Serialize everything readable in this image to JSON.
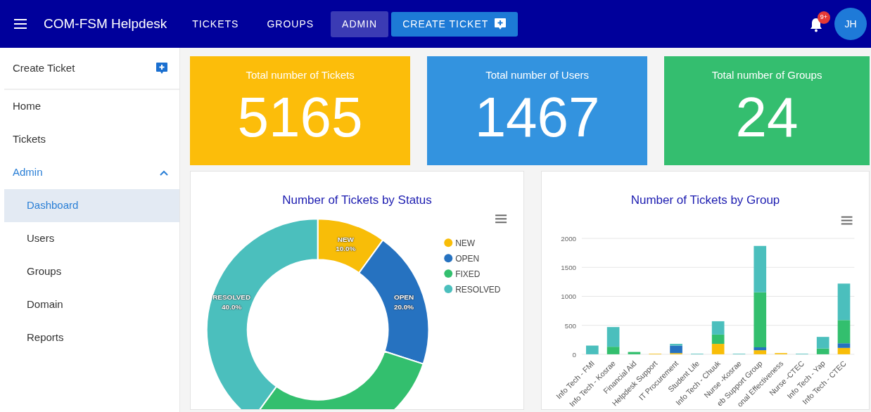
{
  "navbar": {
    "brand": "COM-FSM Helpdesk",
    "tabs": [
      {
        "label": "TICKETS",
        "selected": false
      },
      {
        "label": "GROUPS",
        "selected": false
      },
      {
        "label": "ADMIN",
        "selected": true
      }
    ],
    "create_button": "CREATE TICKET",
    "notification_badge": "9+",
    "avatar": "JH"
  },
  "sidebar": {
    "create_item": "Create Ticket",
    "items": [
      {
        "label": "Home",
        "selected": false
      },
      {
        "label": "Tickets",
        "selected": false
      },
      {
        "label": "Admin",
        "selected": false,
        "expanded": true,
        "children": [
          {
            "label": "Dashboard",
            "selected": true
          },
          {
            "label": "Users",
            "selected": false
          },
          {
            "label": "Groups",
            "selected": false
          },
          {
            "label": "Domain",
            "selected": false
          },
          {
            "label": "Reports",
            "selected": false
          }
        ]
      }
    ]
  },
  "stats": [
    {
      "label": "Total number of Tickets",
      "value": "5165",
      "color": "#fcbd0a"
    },
    {
      "label": "Total number of Users",
      "value": "1467",
      "color": "#3393df"
    },
    {
      "label": "Total number of Groups",
      "value": "24",
      "color": "#34be6f"
    }
  ],
  "charts": [
    {
      "chart_data": {
        "type": "donut",
        "title": "Number of Tickets by Status",
        "categories": [
          "NEW",
          "OPEN",
          "FIXED",
          "RESOLVED"
        ],
        "series": [
          {
            "values": [
              10,
              20,
              30,
              40
            ]
          }
        ],
        "colors": [
          "#f8bd08",
          "#2672c0",
          "#33bf6e",
          "#4bbfbd"
        ],
        "value_labels": [
          "10.0%",
          "20.0%",
          null,
          "40.0%"
        ],
        "legend": true
      }
    },
    {
      "chart_data": {
        "type": "bar",
        "title": "Number of Tickets by Group",
        "stacked": true,
        "grid": true,
        "categories": [
          "Info Tech - FMI",
          "Info Tech - Kosrae",
          "Financial Aid",
          "Helpdesk Support",
          "IT Procurement",
          "Student Life",
          "Info Tech - Chuuk",
          "Nurse -Kosrae",
          "eb Support Group",
          "onal Effectiveness",
          "Nurse -CTEC",
          "Info Tech - Yap",
          "Info Tech - CTEC"
        ],
        "series": [
          {
            "color": "#f8bd08",
            "values": [
              0,
              0,
              0,
              10,
              20,
              0,
              180,
              0,
              70,
              20,
              0,
              0,
              110
            ]
          },
          {
            "color": "#2672c0",
            "values": [
              0,
              0,
              0,
              0,
              130,
              0,
              0,
              0,
              50,
              0,
              0,
              0,
              80
            ]
          },
          {
            "color": "#33bf6e",
            "values": [
              0,
              130,
              40,
              0,
              0,
              0,
              160,
              0,
              950,
              0,
              0,
              100,
              400
            ]
          },
          {
            "color": "#4bbfbd",
            "values": [
              150,
              340,
              0,
              0,
              30,
              10,
              230,
              10,
              800,
              0,
              10,
              200,
              630
            ]
          }
        ],
        "ylim": [
          0,
          2000
        ],
        "yticks": [
          0,
          500,
          1000,
          1500,
          2000
        ]
      }
    }
  ]
}
